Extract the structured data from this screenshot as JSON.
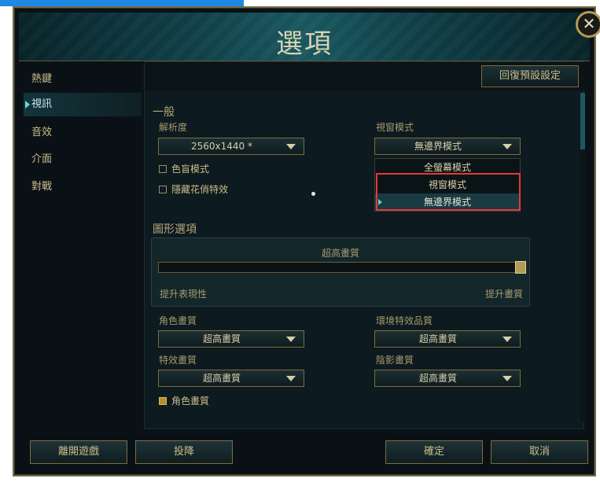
{
  "dialog": {
    "title": "選項",
    "close_symbol": "✕",
    "restore_defaults": "回復預設設定"
  },
  "sidebar": {
    "items": [
      {
        "label": "熱鍵"
      },
      {
        "label": "視訊",
        "active": true
      },
      {
        "label": "音效"
      },
      {
        "label": "介面"
      },
      {
        "label": "對戰"
      }
    ]
  },
  "general": {
    "heading": "一般",
    "resolution_label": "解析度",
    "resolution_value": "2560x1440 *",
    "colorblind_label": "色盲模式",
    "hide_flair_label": "隱藏花俏特效",
    "window_mode_label": "視窗模式",
    "window_mode_value": "無邊界模式",
    "window_mode_options": [
      "全螢幕模式",
      "視窗模式",
      "無邊界模式"
    ],
    "window_mode_selected_index": 2
  },
  "graphics": {
    "heading": "圖形選項",
    "level_label": "超高畫質",
    "slider_value": 1.0,
    "left_label": "提升表現性",
    "right_label": "提升畫質",
    "character_quality_label": "角色畫質",
    "character_quality_value": "超高畫質",
    "environment_quality_label": "環境特效品質",
    "environment_quality_value": "超高畫質",
    "effects_quality_label": "特效畫質",
    "effects_quality_value": "超高畫質",
    "shadow_quality_label": "陰影畫質",
    "shadow_quality_value": "超高畫質",
    "character_inking_label": "角色畫質",
    "character_inking_checked": true
  },
  "footer": {
    "exit_game": "離開遊戲",
    "surrender": "投降",
    "confirm": "確定",
    "cancel": "取消"
  },
  "colors": {
    "gold": "#cbbd8a",
    "teal_accent": "#6fd3df",
    "highlight_red": "#e53935"
  }
}
